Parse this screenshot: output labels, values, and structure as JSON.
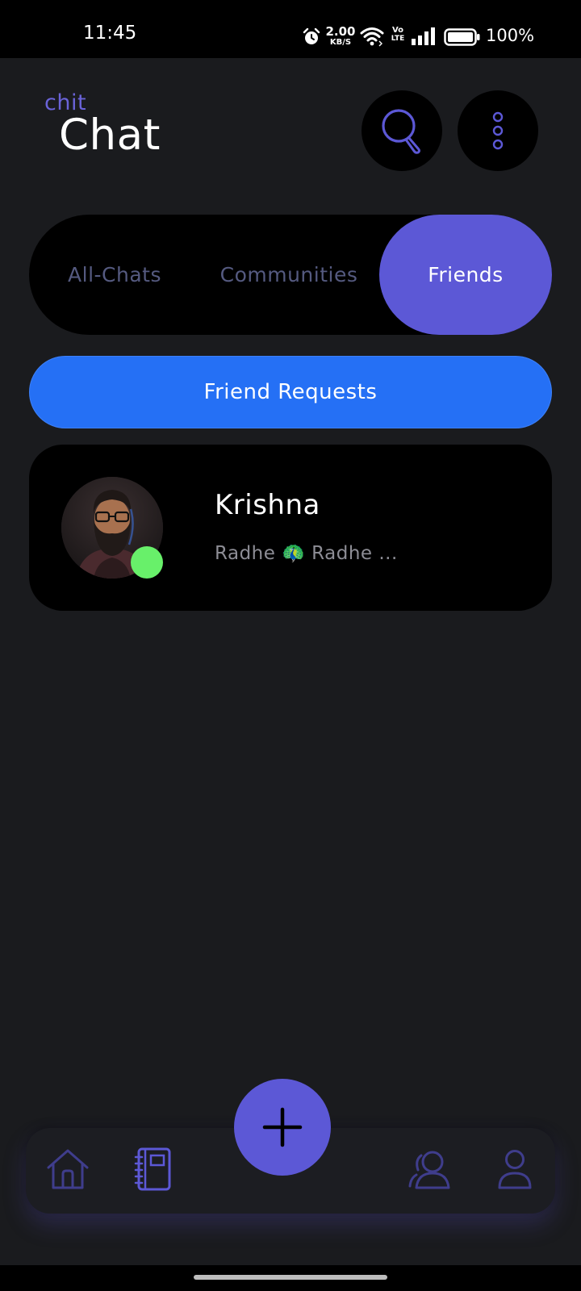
{
  "status_bar": {
    "time": "11:45",
    "net_speed_value": "2.00",
    "net_speed_unit": "KB/S",
    "volte_top": "Vo",
    "volte_bottom": "LTE",
    "battery_percent": "100%"
  },
  "header": {
    "brand_small": "chit",
    "brand_big": "Chat",
    "search_icon": "search-icon",
    "more_icon": "more-vertical-icon"
  },
  "tabs": [
    {
      "label": "All-Chats",
      "active": false
    },
    {
      "label": "Communities",
      "active": false
    },
    {
      "label": "Friends",
      "active": true
    }
  ],
  "friend_requests_label": "Friend Requests",
  "friends": [
    {
      "name": "Krishna",
      "last_message": "Radhe 🦚 Radhe ...",
      "online": true
    }
  ],
  "bottom_nav": {
    "items": [
      "home-icon",
      "notebook-icon",
      "people-icon",
      "profile-icon"
    ],
    "fab_icon": "plus-icon"
  },
  "colors": {
    "background": "#1a1b1e",
    "accent": "#5c58d6",
    "friend_requests": "#2570f5",
    "online": "#68f06a",
    "inactive_tab": "#555a80"
  }
}
